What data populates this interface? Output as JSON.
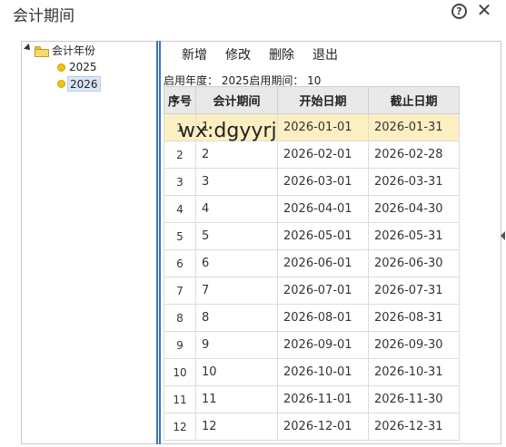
{
  "window": {
    "title": "会计期间"
  },
  "tree": {
    "root_label": "会计年份",
    "years": [
      "2025",
      "2026"
    ],
    "selected_year": "2026"
  },
  "toolbar": {
    "add_label": "新增",
    "edit_label": "修改",
    "delete_label": "删除",
    "exit_label": "退出"
  },
  "info": {
    "text": "启用年度： 2025启用期间： 10"
  },
  "table": {
    "headers": [
      "序号",
      "会计期间",
      "开始日期",
      "截止日期"
    ],
    "rows": [
      [
        "1",
        "1",
        "2026-01-01",
        "2026-01-31"
      ],
      [
        "2",
        "2",
        "2026-02-01",
        "2026-02-28"
      ],
      [
        "3",
        "3",
        "2026-03-01",
        "2026-03-31"
      ],
      [
        "4",
        "4",
        "2026-04-01",
        "2026-04-30"
      ],
      [
        "5",
        "5",
        "2026-05-01",
        "2026-05-31"
      ],
      [
        "6",
        "6",
        "2026-06-01",
        "2026-06-30"
      ],
      [
        "7",
        "7",
        "2026-07-01",
        "2026-07-31"
      ],
      [
        "8",
        "8",
        "2026-08-01",
        "2026-08-31"
      ],
      [
        "9",
        "9",
        "2026-09-01",
        "2026-09-30"
      ],
      [
        "10",
        "10",
        "2026-10-01",
        "2026-10-31"
      ],
      [
        "11",
        "11",
        "2026-11-01",
        "2026-11-30"
      ],
      [
        "12",
        "12",
        "2026-12-01",
        "2026-12-31"
      ]
    ],
    "selected_row": "1"
  },
  "watermark": {
    "text": "wx:dgyyrj"
  },
  "colors": {
    "selected_row": "#fcefc2",
    "divider": "#3b73c2",
    "header_bg": "#e9e9e9",
    "node_dot": "#f1c40f"
  },
  "icons": {
    "help": "help-circle-icon",
    "close": "close-icon",
    "folder": "folder-icon",
    "expander": "expand-triangle-icon",
    "node": "circle-dot-icon"
  }
}
